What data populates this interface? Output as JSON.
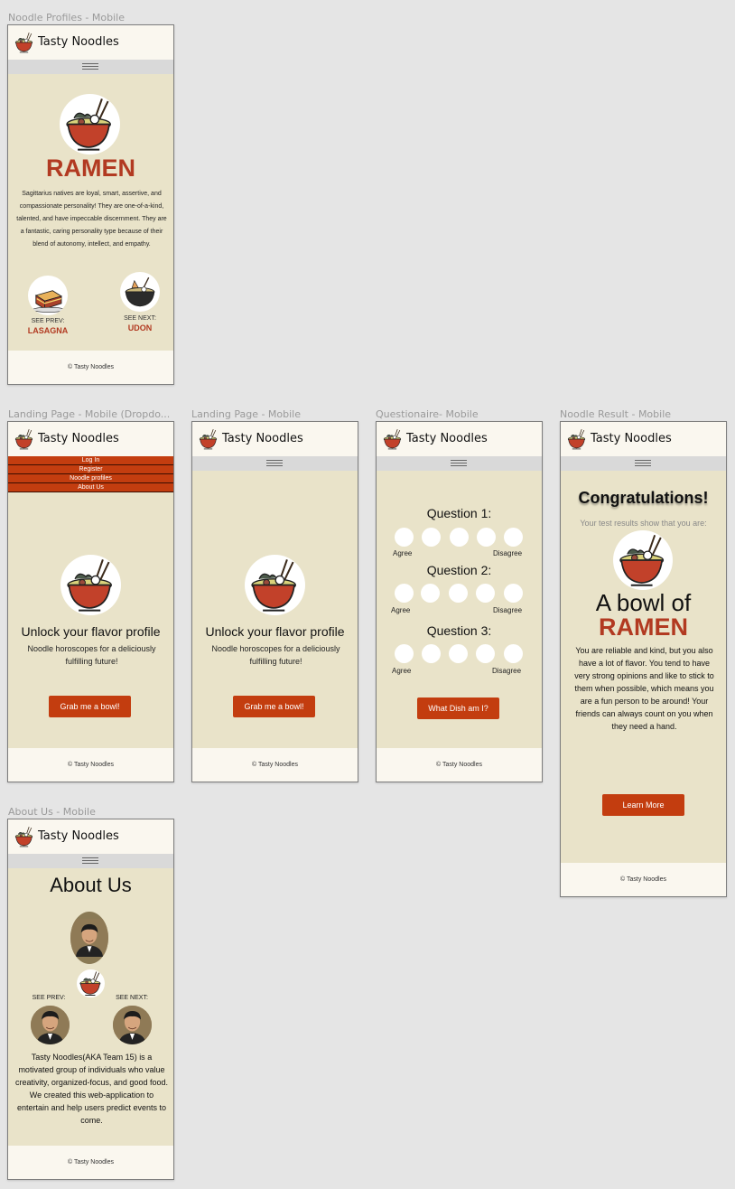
{
  "brand": "Tasty Noodles",
  "footer": "© Tasty Noodles",
  "labels": {
    "profiles": "Noodle Profiles - Mobile",
    "landing_dd": "Landing Page - Mobile (Dropdo...",
    "landing": "Landing Page - Mobile",
    "quiz": "Questionaire- Mobile",
    "result": "Noodle Result - Mobile",
    "about": "About Us - Mobile"
  },
  "profile": {
    "title": "RAMEN",
    "desc": "Sagittarius natives are loyal, smart, assertive, and compassionate personality! They are one-of-a-kind, talented, and have impeccable discernment. They are a fantastic, caring personality type because of their blend of autonomy, intellect, and empathy.",
    "prev_caption": "SEE PREV:",
    "prev_name": "LASAGNA",
    "next_caption": "SEE NEXT:",
    "next_name": "UDON"
  },
  "landing": {
    "headline": "Unlock your flavor profile",
    "sub": "Noodle horoscopes for a deliciously fulfilling future!",
    "cta": "Grab me a bowl!"
  },
  "dropdown": [
    "Log In",
    "Register",
    "Noodle profiles",
    "About Us"
  ],
  "quiz": {
    "questions": [
      "Question 1:",
      "Question 2:",
      "Question 3:"
    ],
    "agree": "Agree",
    "disagree": "Disagree",
    "submit": "What Dish am I?"
  },
  "result": {
    "congrats": "Congratulations!",
    "sub": "Your test results show that you are:",
    "line1": "A bowl of",
    "line2": "RAMEN",
    "desc": "You are reliable and kind, but you also have a lot of flavor. You tend to have very strong opinions and like to stick to them when possible, which means you are a fun person to be around! Your friends can always count on you when they need a hand.",
    "cta": "Learn More"
  },
  "about": {
    "title": "About Us",
    "prev_caption": "SEE PREV:",
    "next_caption": "SEE NEXT:",
    "desc": "Tasty Noodles(AKA Team 15) is a motivated group of individuals who value creativity, organized-focus, and good food. We created this web-application to entertain and help users predict events to come."
  },
  "colors": {
    "accent": "#c33d0f",
    "title_red": "#b23a21",
    "bg": "#e9e3c9",
    "header": "#faf7ef",
    "menubar": "#d9d9d9",
    "canvas": "#e5e5e5"
  },
  "icons": [
    "ramen-bowl-icon",
    "lasagna-icon",
    "udon-bowl-icon",
    "hamburger-menu-icon"
  ]
}
